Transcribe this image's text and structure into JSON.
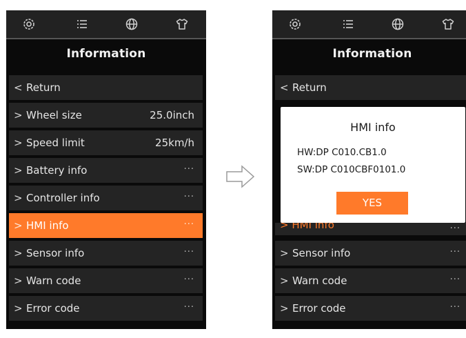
{
  "top_icons": [
    "gear-icon",
    "list-icon",
    "globe-icon",
    "shirt-icon"
  ],
  "left": {
    "title": "Information",
    "items": [
      {
        "label": "Return",
        "chevron": "<",
        "value": ""
      },
      {
        "label": "Wheel size",
        "chevron": ">",
        "value": "25.0inch"
      },
      {
        "label": "Speed limit",
        "chevron": ">",
        "value": "25km/h"
      },
      {
        "label": "Battery info",
        "chevron": ">",
        "value": "..."
      },
      {
        "label": "Controller info",
        "chevron": ">",
        "value": "..."
      },
      {
        "label": "HMI info",
        "chevron": ">",
        "value": "...",
        "active": true
      },
      {
        "label": "Sensor info",
        "chevron": ">",
        "value": "..."
      },
      {
        "label": "Warn code",
        "chevron": ">",
        "value": "..."
      },
      {
        "label": "Error code",
        "chevron": ">",
        "value": "..."
      }
    ]
  },
  "right": {
    "title": "Information",
    "return": {
      "label": "Return",
      "chevron": "<"
    },
    "dialog": {
      "title": "HMI info",
      "hw": "HW:DP C010.CB1.0",
      "sw": "SW:DP C010CBF0101.0",
      "yes_label": "YES"
    },
    "obscured": {
      "label": "> HMI info",
      "value": "..."
    },
    "items": [
      {
        "label": "Sensor info",
        "chevron": ">",
        "value": "..."
      },
      {
        "label": "Warn code",
        "chevron": ">",
        "value": "..."
      },
      {
        "label": "Error code",
        "chevron": ">",
        "value": "..."
      }
    ]
  },
  "colors": {
    "accent": "#ff7a2a",
    "background": "#0a0a0a",
    "row": "#242424",
    "topbar": "#222222"
  }
}
